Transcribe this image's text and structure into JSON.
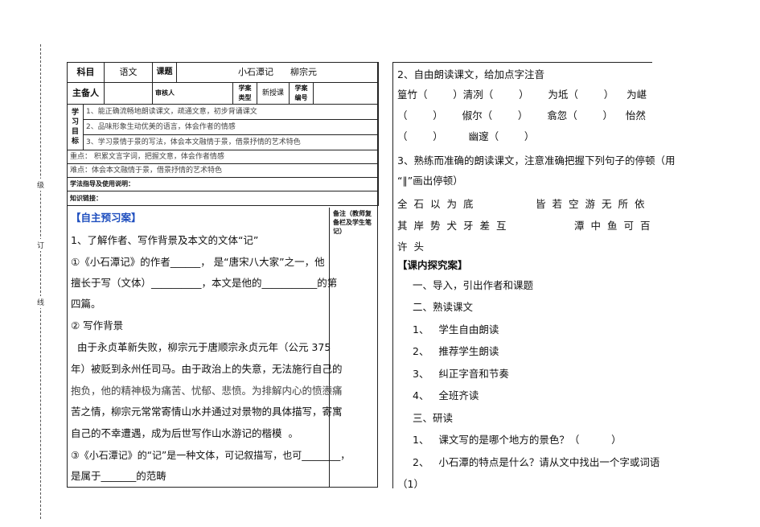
{
  "margin": {
    "labels": [
      "级",
      "订",
      "线"
    ]
  },
  "info": {
    "subject_label": "科目",
    "subject": "语文",
    "topic_label": "课题",
    "topic": "小石潭记      柳宗元",
    "preparer_label": "主备人",
    "reviewer_label": "审核人",
    "type_label": "学案类型",
    "type_value": "新授课",
    "number_label": "学案编号",
    "objectives_label": "学习目标",
    "objectives": [
      "1、能正确流畅地朗读课文，疏通文意，初步背诵课文",
      "2、品味形象生动优美的语言，体会作者的情感",
      "3、学习景情于景的写法，体会本文融情于景，借景抒情的艺术特色"
    ],
    "key_point": "重点：  积累文言字词，把握文意，体会作者情感",
    "difficulty": "难点：体会本文融情于景，借景抒情的艺术特色",
    "guide": "学法指导及使用说明：",
    "link": "知识链接："
  },
  "notes": {
    "header": "备注（教师复备栏及学生笔记）"
  },
  "preview": {
    "title": "【自主预习案】",
    "lines": [
      "1、了解作者、写作背景及本文的文体“记”",
      "①《小石潭记》的作者______，   是“唐宋八大家”之一，他",
      "擅长于写（文体）__________，本文是他的___________的第",
      "四篇。",
      "② 写作背景",
      "  由于永贞革新失败，柳宗元于唐顺宗永贞元年（公元 375",
      "年）被贬到永州任司马。由于政治上的失意，无法施行自己的",
      "抱负，他的精神极为痛苦、忧郁、悲愤。为排解内心的愤懑痛",
      "苦之情，柳宗元常常寄情山水并通过对景物的具体描写，寄寓",
      "自己的不幸遭遇，成为后世写作山水游记的楷模  。",
      "③《小石潭记》的“记”是一种文体，可记叙描写，也可________，",
      "是属于_______的范畴"
    ]
  },
  "right": {
    "lines": [
      "2、自由朗读课文，给加点字注音",
      "篁竹（        ）清冽（        ）      为坻（        ）    为嵁",
      "（        ）      俶尔（        ）      翕忽（        ）    怡然",
      "（        ）        幽邃（        ）",
      "3、熟练而准确的朗读课文，注意准确把握下列句子的停顿（用",
      "“∥”画出停顿）"
    ],
    "sentence1a": "全石以为底",
    "sentence1b": "皆若空游无所依",
    "sentence2a": "其岸势犬牙差互",
    "sentence2b": "潭中鱼可百",
    "sentence3": "许头",
    "explore_title": "【课内探究案】",
    "steps": [
      "一、导入，引出作者和课题",
      "二、熟读课文",
      "1、   学生自由朗读",
      "2、   推荐学生朗读",
      "3、   纠正字音和节奏",
      "4、   全班齐读",
      "三、研读",
      "1、   课文写的是哪个地方的景色？（          ）",
      "2、   小石潭的特点是什么？请从文中找出一个字或词语",
      "（1）"
    ]
  }
}
